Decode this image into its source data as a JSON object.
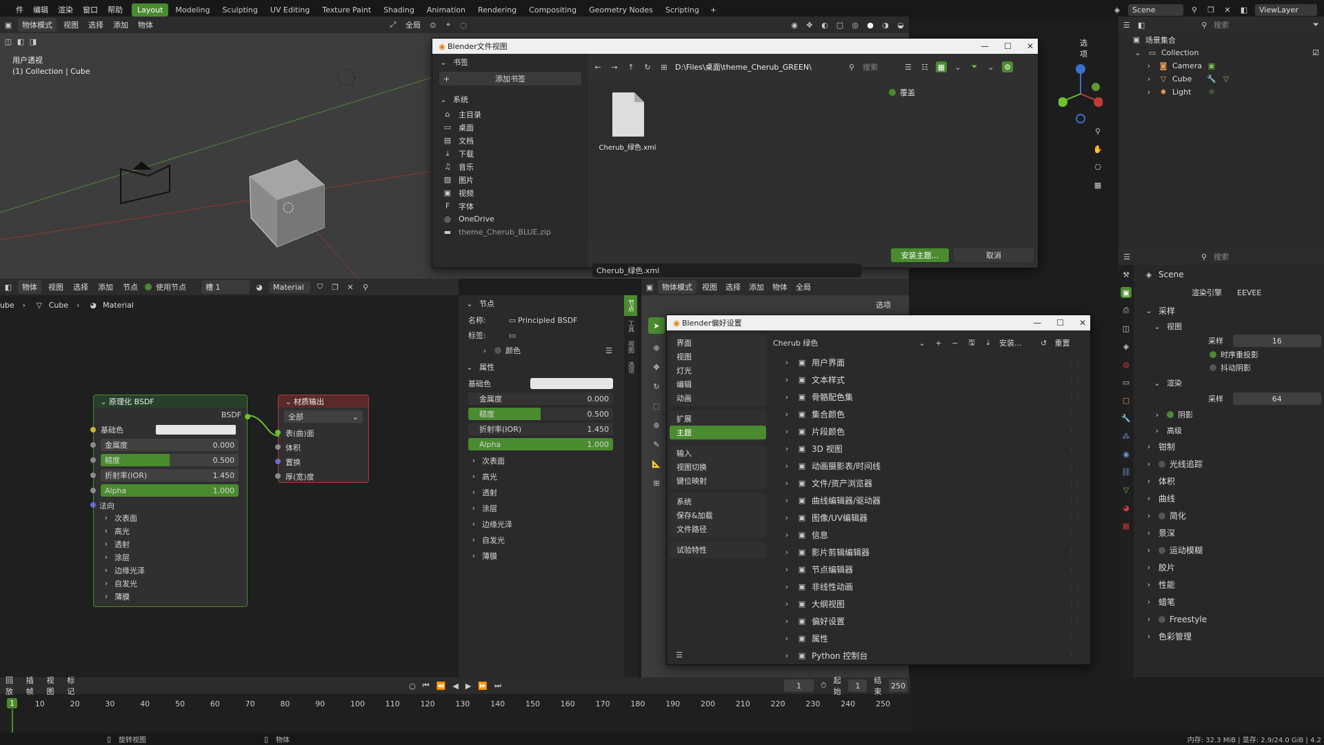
{
  "menubar": {
    "menus": [
      "件",
      "编辑",
      "渲染",
      "窗口",
      "帮助"
    ],
    "workspaces": [
      "Layout",
      "Modeling",
      "Sculpting",
      "UV Editing",
      "Texture Paint",
      "Shading",
      "Animation",
      "Rendering",
      "Compositing",
      "Geometry Nodes",
      "Scripting"
    ],
    "active_workspace": "Layout",
    "add_workspace": "+",
    "scene": "Scene",
    "viewlayer": "ViewLayer"
  },
  "viewport": {
    "mode": "物体模式",
    "menus": [
      "视图",
      "选择",
      "添加",
      "物体"
    ],
    "transform": "全局",
    "options": "选项",
    "info_line1": "用户透视",
    "info_line2": "(1) Collection | Cube"
  },
  "file_browser": {
    "title": "Blender文件视图",
    "bookmarks_header": "书签",
    "add_bookmark": "添加书签",
    "system_header": "系统",
    "system_items": [
      {
        "icon": "home-icon",
        "glyph": "⌂",
        "label": "主目录"
      },
      {
        "icon": "desktop-icon",
        "glyph": "▭",
        "label": "桌面"
      },
      {
        "icon": "documents-icon",
        "glyph": "▤",
        "label": "文档"
      },
      {
        "icon": "download-icon",
        "glyph": "⤓",
        "label": "下载"
      },
      {
        "icon": "music-icon",
        "glyph": "♫",
        "label": "音乐"
      },
      {
        "icon": "pictures-icon",
        "glyph": "▨",
        "label": "图片"
      },
      {
        "icon": "video-icon",
        "glyph": "▣",
        "label": "视频"
      },
      {
        "icon": "font-icon",
        "glyph": "F",
        "label": "字体"
      },
      {
        "icon": "onedrive-icon",
        "glyph": "◎",
        "label": "OneDrive"
      },
      {
        "icon": "folder-icon",
        "glyph": "▬",
        "label": "theme_Cherub_BLUE.zip"
      }
    ],
    "path": "D:\\Files\\桌面\\theme_Cherub_GREEN\\",
    "search_placeholder": "搜索",
    "file_name": "Cherub_绿色.xml",
    "overwrite_label": "覆盖",
    "filename_value": "Cherub_绿色.xml",
    "install_button": "安装主题...",
    "cancel_button": "取消"
  },
  "node_editor": {
    "object": "物体",
    "menus": [
      "视图",
      "选择",
      "添加",
      "节点"
    ],
    "use_nodes": "使用节点",
    "slot": "槽 1",
    "material": "Material",
    "breadcrumb": [
      "ube",
      "Cube",
      "Material"
    ],
    "bsdf_node": {
      "title": "原理化 BSDF",
      "output": "BSDF",
      "rows": [
        {
          "label": "基础色",
          "type": "color"
        },
        {
          "label": "金属度",
          "value": "0.000",
          "fill": 0
        },
        {
          "label": "糙度",
          "value": "0.500",
          "fill": 0.5
        },
        {
          "label": "折射率(IOR)",
          "value": "1.450",
          "fill": 0
        },
        {
          "label": "Alpha",
          "value": "1.000",
          "fill": 1
        }
      ],
      "normal": "法向",
      "subs": [
        "次表面",
        "高光",
        "透射",
        "涂层",
        "边缘光泽",
        "自发光",
        "薄膜"
      ]
    },
    "output_node": {
      "title": "材质输出",
      "target": "全部",
      "inputs": [
        "表(曲)面",
        "体积",
        "置换",
        "厚(宽)度"
      ]
    }
  },
  "node_props": {
    "node_header": "节点",
    "name_label": "名称:",
    "name_value": "Principled BSDF",
    "label_label": "标签:",
    "color_label": "颜色",
    "props_header": "属性",
    "base_color": "基础色",
    "rows": [
      {
        "label": "金属度",
        "value": "0.000",
        "fill": 0
      },
      {
        "label": "糙度",
        "value": "0.500",
        "fill": 0.5
      },
      {
        "label": "折射率(IOR)",
        "value": "1.450",
        "fill": 0
      },
      {
        "label": "Alpha",
        "value": "1.000",
        "fill": 1
      }
    ],
    "subs": [
      "次表面",
      "高光",
      "透射",
      "涂层",
      "边缘光泽",
      "自发光",
      "薄膜"
    ],
    "tabs": [
      "节点",
      "工具",
      "视图",
      "选项"
    ]
  },
  "viewport2": {
    "mode": "物体模式",
    "menus": [
      "视图",
      "选择",
      "添加",
      "物体"
    ],
    "transform": "全局",
    "options": "选项"
  },
  "prefs": {
    "title": "Blender偏好设置",
    "groups": [
      [
        "界面",
        "视图",
        "灯光",
        "编辑",
        "动画"
      ],
      [
        "扩展",
        "主题"
      ],
      [
        "输入",
        "视图切换",
        "键位映射"
      ],
      [
        "系统",
        "保存&加载",
        "文件路径"
      ],
      [
        "试验特性"
      ]
    ],
    "selected": "主题",
    "preset": "Cherub 绿色",
    "install": "安装...",
    "reset": "重置",
    "themes": [
      {
        "icon": "ui-icon",
        "label": "用户界面"
      },
      {
        "icon": "text-style-icon",
        "label": "文本样式"
      },
      {
        "icon": "bone-color-icon",
        "label": "骨骼配色集"
      },
      {
        "icon": "collection-color-icon",
        "label": "集合颜色"
      },
      {
        "icon": "strip-color-icon",
        "label": "片段颜色"
      },
      {
        "icon": "3dview-icon",
        "label": "3D 视图"
      },
      {
        "icon": "dopesheet-icon",
        "label": "动画摄影表/时间线"
      },
      {
        "icon": "file-browser-icon",
        "label": "文件/资产浏览器"
      },
      {
        "icon": "graph-editor-icon",
        "label": "曲线编辑器/驱动器"
      },
      {
        "icon": "image-editor-icon",
        "label": "图像/UV编辑器"
      },
      {
        "icon": "info-icon",
        "label": "信息"
      },
      {
        "icon": "clip-editor-icon",
        "label": "影片剪辑编辑器"
      },
      {
        "icon": "node-editor-icon",
        "label": "节点编辑器"
      },
      {
        "icon": "nla-icon",
        "label": "非线性动画"
      },
      {
        "icon": "outliner-icon",
        "label": "大纲视图"
      },
      {
        "icon": "preferences-icon",
        "label": "偏好设置"
      },
      {
        "icon": "properties-icon",
        "label": "属性"
      },
      {
        "icon": "console-icon",
        "label": "Python 控制台"
      }
    ]
  },
  "outliner": {
    "search_placeholder": "搜索",
    "scene_collection": "场景集合",
    "collection": "Collection",
    "items": [
      "Camera",
      "Cube",
      "Light"
    ]
  },
  "properties": {
    "search_placeholder": "搜索",
    "scene": "Scene",
    "render_engine_label": "渲染引擎",
    "render_engine": "EEVEE",
    "sampling": "采样",
    "viewport": "视图",
    "samples_label": "采样",
    "viewport_samples": "16",
    "temporal_reprojection": "时序重投影",
    "jitter_shadows": "抖动阴影",
    "render": "渲染",
    "render_samples": "64",
    "shadows": "阴影",
    "advanced": "高级",
    "panels": [
      "钳制",
      "光线追踪",
      "体积",
      "曲线",
      "简化",
      "景深",
      "运动模糊",
      "胶片",
      "性能",
      "蜡笔",
      "Freestyle",
      "色彩管理"
    ]
  },
  "timeline": {
    "menus": [
      "回放",
      "插帧",
      "视图",
      "标记"
    ],
    "current_frame": "1",
    "start_label": "起始",
    "start": "1",
    "end_label": "结束",
    "end": "250",
    "ticks": [
      "10",
      "20",
      "30",
      "40",
      "50",
      "60",
      "70",
      "80",
      "90",
      "100",
      "110",
      "120",
      "130",
      "140",
      "150",
      "160",
      "170",
      "180",
      "190",
      "200",
      "210",
      "220",
      "230",
      "240",
      "250"
    ],
    "playhead": "1"
  },
  "statusbar": {
    "rotate": "旋转视图",
    "object": "物体",
    "memory": "内存: 32.3 MiB | 显存: 2.9/24.0 GiB | 4.2"
  },
  "colors": {
    "accent": "#4a8b2f"
  }
}
